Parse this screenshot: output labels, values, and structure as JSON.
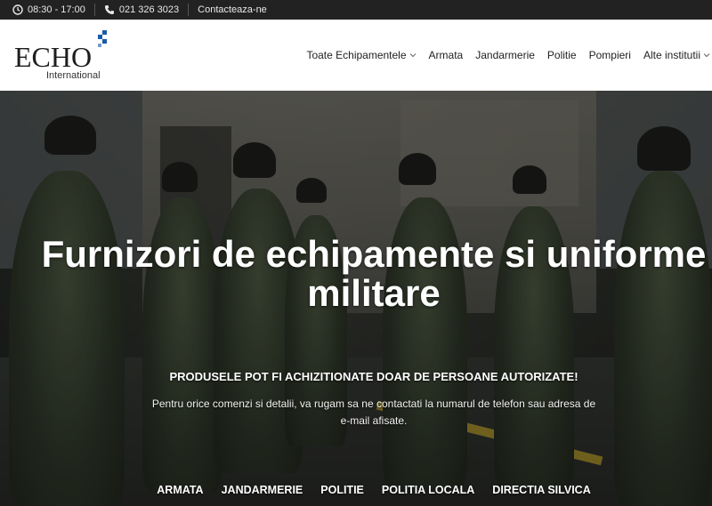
{
  "topbar": {
    "hours": "08:30 - 17:00",
    "phone": "021 326 3023",
    "contact": "Contacteaza-ne"
  },
  "logo": {
    "name": "ECHO",
    "subtitle": "International",
    "accent_color": "#1a5aa8"
  },
  "nav": {
    "items": [
      {
        "label": "Toate Echipamentele",
        "dropdown": true
      },
      {
        "label": "Armata",
        "dropdown": false
      },
      {
        "label": "Jandarmerie",
        "dropdown": false
      },
      {
        "label": "Politie",
        "dropdown": false
      },
      {
        "label": "Pompieri",
        "dropdown": false
      },
      {
        "label": "Alte institutii",
        "dropdown": true
      }
    ]
  },
  "hero": {
    "title": "Furnizori de echipamente si uniforme\nmilitare",
    "notice": "PRODUSELE POT FI ACHIZITIONATE DOAR DE PERSOANE AUTORIZATE!",
    "subtext": "Pentru orice comenzi si detalii, va rugam sa ne contactati la numarul de telefon sau adresa de e-mail afisate.",
    "categories": [
      "ARMATA",
      "JANDARMERIE",
      "POLITIE",
      "POLITIA LOCALA",
      "DIRECTIA SILVICA"
    ]
  },
  "icons": {
    "clock": "clock-icon",
    "phone": "phone-icon",
    "chevron": "chevron-down-icon"
  }
}
